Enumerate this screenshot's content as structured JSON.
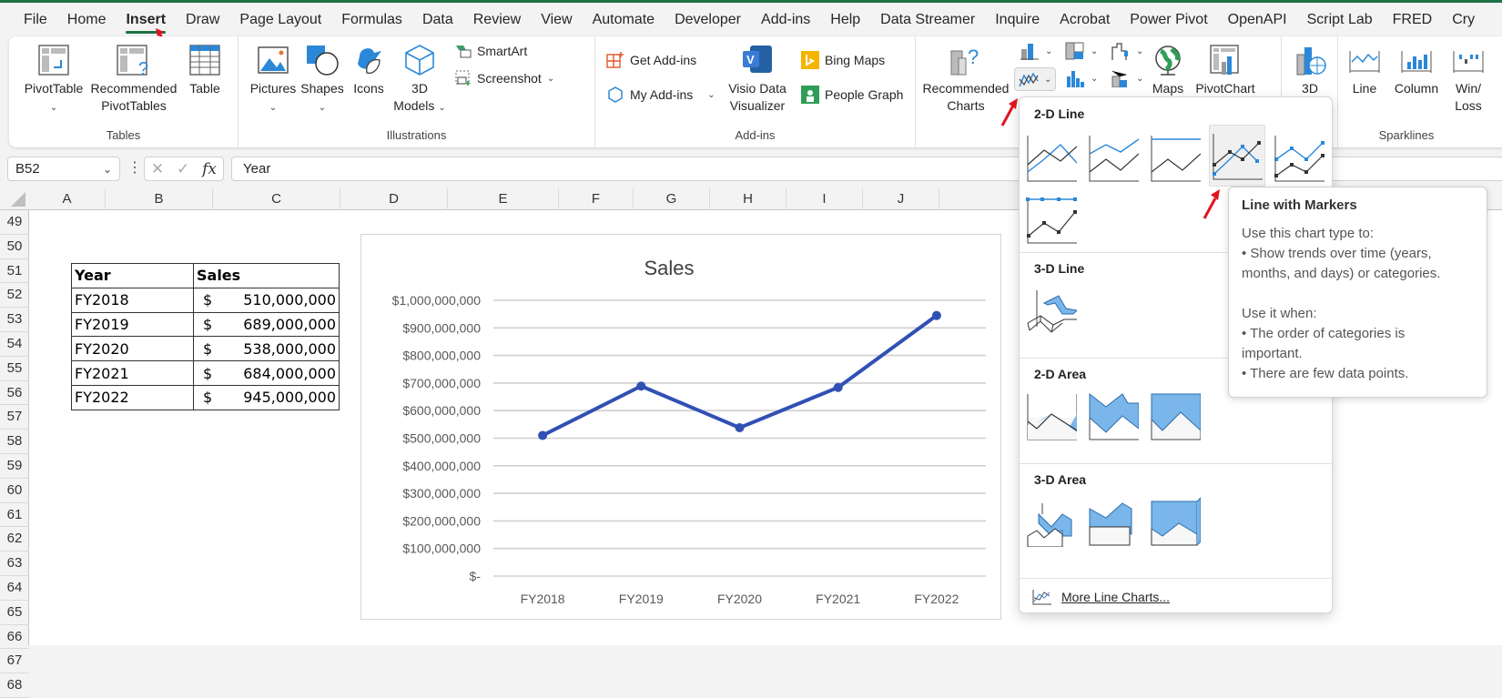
{
  "menu": {
    "tabs": [
      "File",
      "Home",
      "Insert",
      "Draw",
      "Page Layout",
      "Formulas",
      "Data",
      "Review",
      "View",
      "Automate",
      "Developer",
      "Add-ins",
      "Help",
      "Data Streamer",
      "Inquire",
      "Acrobat",
      "Power Pivot",
      "OpenAPI",
      "Script Lab",
      "FRED",
      "Cry"
    ],
    "active_tab": "Insert"
  },
  "ribbon": {
    "tables": {
      "label": "Tables",
      "pivottable": "PivotTable",
      "recommended_pivottables_1": "Recommended",
      "recommended_pivottables_2": "PivotTables",
      "table": "Table"
    },
    "illustrations": {
      "label": "Illustrations",
      "pictures": "Pictures",
      "shapes": "Shapes",
      "icons": "Icons",
      "models_1": "3D",
      "models_2": "Models",
      "smartart": "SmartArt",
      "screenshot": "Screenshot"
    },
    "addins": {
      "label": "Add-ins",
      "get_addins": "Get Add-ins",
      "my_addins": "My Add-ins",
      "visio_1": "Visio Data",
      "visio_2": "Visualizer",
      "bing_maps": "Bing Maps",
      "people_graph": "People Graph"
    },
    "charts": {
      "recommended_1": "Recommended",
      "recommended_2": "Charts",
      "maps": "Maps",
      "pivotchart": "PivotChart",
      "threed": "3D"
    },
    "sparklines": {
      "label": "Sparklines",
      "line": "Line",
      "column": "Column",
      "winloss_1": "Win/",
      "winloss_2": "Loss"
    }
  },
  "formula_bar": {
    "name_box": "B52",
    "fx": "fx",
    "value": "Year"
  },
  "grid": {
    "columns": [
      "A",
      "B",
      "C",
      "D",
      "E",
      "F",
      "G",
      "H",
      "I",
      "J"
    ],
    "rows": [
      "49",
      "50",
      "51",
      "52",
      "53",
      "54",
      "55",
      "56",
      "57",
      "58",
      "59",
      "60",
      "61",
      "62",
      "63",
      "64",
      "65",
      "66",
      "67",
      "68"
    ]
  },
  "table": {
    "headers": [
      "Year",
      "Sales"
    ],
    "rows": [
      {
        "year": "FY2018",
        "currency": "$",
        "sales": "510,000,000"
      },
      {
        "year": "FY2019",
        "currency": "$",
        "sales": "689,000,000"
      },
      {
        "year": "FY2020",
        "currency": "$",
        "sales": "538,000,000"
      },
      {
        "year": "FY2021",
        "currency": "$",
        "sales": "684,000,000"
      },
      {
        "year": "FY2022",
        "currency": "$",
        "sales": "945,000,000"
      }
    ]
  },
  "chart_data": {
    "type": "line",
    "title": "Sales",
    "categories": [
      "FY2018",
      "FY2019",
      "FY2020",
      "FY2021",
      "FY2022"
    ],
    "series": [
      {
        "name": "Sales",
        "values": [
          510000000,
          689000000,
          538000000,
          684000000,
          945000000
        ],
        "color": "#3050b4",
        "markers": true
      }
    ],
    "xlabel": "",
    "ylabel": "",
    "ylim": [
      0,
      1000000000
    ],
    "yticks": [
      0,
      100000000,
      200000000,
      300000000,
      400000000,
      500000000,
      600000000,
      700000000,
      800000000,
      900000000,
      1000000000
    ],
    "ytick_labels": [
      "$-",
      "$100,000,000",
      "$200,000,000",
      "$300,000,000",
      "$400,000,000",
      "$500,000,000",
      "$600,000,000",
      "$700,000,000",
      "$800,000,000",
      "$900,000,000",
      "$1,000,000,000"
    ],
    "grid": true,
    "legend": "none"
  },
  "gallery": {
    "sections": [
      "2-D Line",
      "3-D Line",
      "2-D Area",
      "3-D Area"
    ],
    "more": "More Line Charts...",
    "selected": "Line with Markers"
  },
  "tooltip": {
    "title": "Line with Markers",
    "lines": [
      "Use this chart type to:",
      "• Show trends over time (years,",
      "months, and days) or categories.",
      "",
      "Use it when:",
      "• The order of categories is",
      "important.",
      "• There are few data points."
    ]
  },
  "colors": {
    "accent": "#1e7145",
    "chart_line": "#3050b4",
    "icon_blue": "#2b88d8",
    "annotation": "#e0141e"
  }
}
